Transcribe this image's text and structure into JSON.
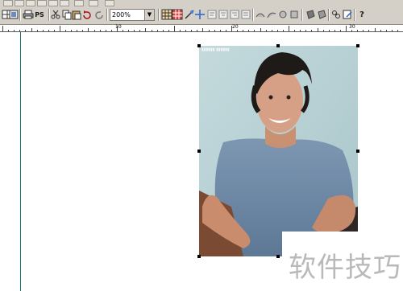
{
  "toolbar": {
    "ps_label": "PS",
    "zoom_value": "200%",
    "help_label": "?"
  },
  "ruler": {
    "labels": [
      "10",
      "20",
      "30"
    ]
  },
  "watermark": {
    "text": "软件技巧"
  },
  "image": {
    "subject": "smiling man in blue t-shirt photo"
  }
}
